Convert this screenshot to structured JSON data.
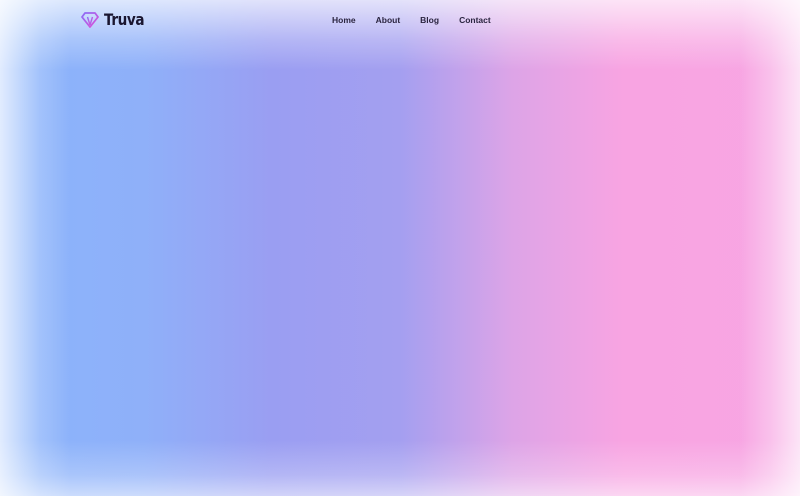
{
  "brand": {
    "name": "Truva",
    "logo_icon": "gem-icon",
    "logo_color": "#c05cf0"
  },
  "nav": {
    "items": [
      {
        "label": "Home"
      },
      {
        "label": "About"
      },
      {
        "label": "Blog"
      },
      {
        "label": "Contact"
      }
    ]
  },
  "background": {
    "gradient_colors": [
      "#8ab4fb",
      "#9a9ef2",
      "#f8a4e2"
    ]
  }
}
